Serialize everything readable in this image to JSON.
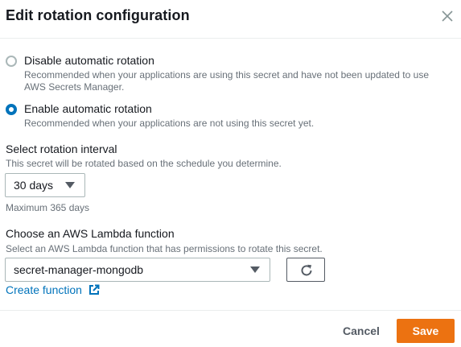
{
  "modal": {
    "title": "Edit rotation configuration",
    "close_icon": "close-icon"
  },
  "rotation": {
    "options": [
      {
        "label": "Disable automatic rotation",
        "description": "Recommended when your applications are using this secret and have not been updated to use AWS Secrets Manager.",
        "selected": false
      },
      {
        "label": "Enable automatic rotation",
        "description": "Recommended when your applications are not using this secret yet.",
        "selected": true
      }
    ]
  },
  "interval": {
    "label": "Select rotation interval",
    "description": "This secret will be rotated based on the schedule you determine.",
    "selected": "30 days",
    "hint": "Maximum 365 days"
  },
  "lambda": {
    "label": "Choose an AWS Lambda function",
    "description": "Select an AWS Lambda function that has permissions to rotate this secret.",
    "selected": "secret-manager-mongodb",
    "refresh_icon": "refresh-icon",
    "create_link": "Create function",
    "external_icon": "external-link-icon"
  },
  "footer": {
    "cancel_label": "Cancel",
    "save_label": "Save"
  },
  "colors": {
    "accent": "#0073bb",
    "primary_button": "#ec7211",
    "muted_text": "#687078"
  }
}
